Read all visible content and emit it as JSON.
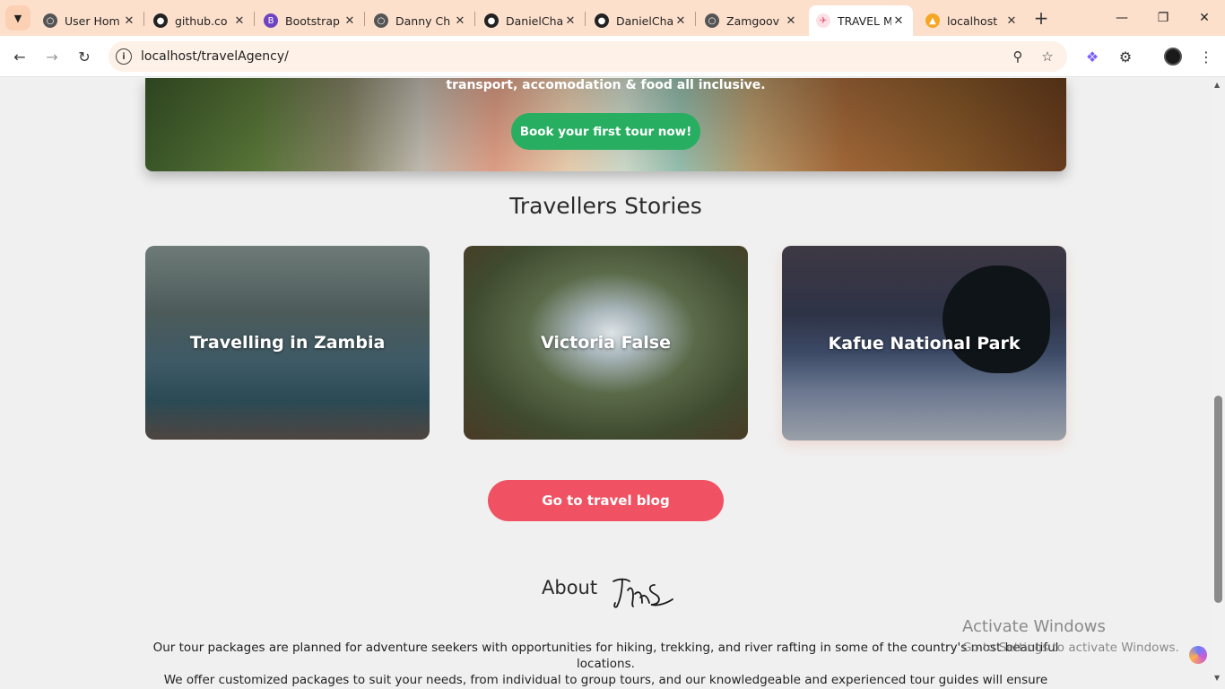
{
  "browser": {
    "tabs": [
      {
        "label": "User Hom",
        "icon": "globe-icon"
      },
      {
        "label": "github.co",
        "icon": "github-icon"
      },
      {
        "label": "Bootstrap",
        "icon": "bootstrap-icon"
      },
      {
        "label": "Danny Ch",
        "icon": "globe-icon"
      },
      {
        "label": "DanielCha",
        "icon": "github-icon"
      },
      {
        "label": "DanielCha",
        "icon": "github-icon"
      },
      {
        "label": "Zamgoov",
        "icon": "globe-icon"
      },
      {
        "label": "TRAVEL M",
        "icon": "travel-icon",
        "active": true
      },
      {
        "label": "localhost",
        "icon": "phpmyadmin-icon"
      }
    ],
    "new_tab": "+",
    "url": "localhost/travelAgency/",
    "accent": "#fde0cc"
  },
  "hero": {
    "subtitle": "transport, accomodation & food all inclusive.",
    "cta": "Book your first tour now!"
  },
  "stories": {
    "title": "Travellers Stories",
    "cards": [
      {
        "title": "Travelling in Zambia"
      },
      {
        "title": "Victoria False"
      },
      {
        "title": "Kafue National Park"
      }
    ],
    "blog_button": "Go to travel blog"
  },
  "about": {
    "heading": "About",
    "logo_text": "TMS",
    "paragraph1": "Our tour packages are planned for adventure seekers with opportunities for hiking, trekking, and river rafting in some of the country's most beautiful locations.",
    "paragraph2": "We offer customized packages to suit your needs, from individual to group tours, and our knowledgeable and experienced tour guides will ensure"
  },
  "watermark": {
    "line1": "Activate Windows",
    "line2": "Go to Settings to activate Windows."
  },
  "colors": {
    "cta_green": "#27ae60",
    "blog_red": "#f05263"
  }
}
